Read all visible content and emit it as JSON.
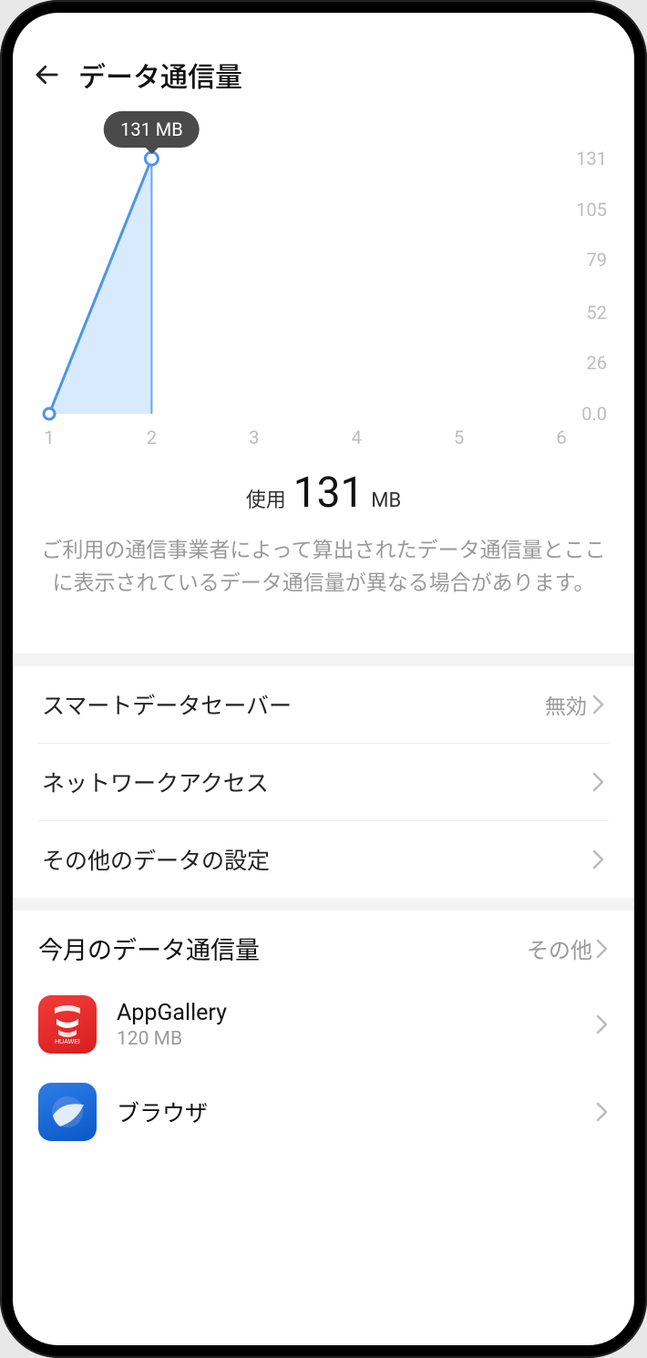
{
  "header": {
    "title": "データ通信量"
  },
  "chart_data": {
    "type": "area",
    "tooltip": "131 MB",
    "x": [
      1,
      2,
      3,
      4,
      5,
      6
    ],
    "values": [
      0,
      131,
      null,
      null,
      null,
      null
    ],
    "xlabel": "",
    "ylabel": "",
    "ylim": [
      0,
      131
    ],
    "xticks": [
      "1",
      "2",
      "3",
      "4",
      "5",
      "6"
    ],
    "yticks": [
      "131",
      "105",
      "79",
      "52",
      "26",
      "0.0"
    ]
  },
  "usage": {
    "prefix": "使用",
    "value": "131",
    "unit": "MB"
  },
  "disclaimer": "ご利用の通信事業者によって算出されたデータ通信量とここに表示されているデータ通信量が異なる場合があります。",
  "settings": [
    {
      "label": "スマートデータセーバー",
      "value": "無効"
    },
    {
      "label": "ネットワークアクセス",
      "value": ""
    },
    {
      "label": "その他のデータの設定",
      "value": ""
    }
  ],
  "month": {
    "title": "今月のデータ通信量",
    "more": "その他",
    "apps": [
      {
        "name": "AppGallery",
        "sub": "120 MB",
        "icon": "red",
        "iconLabel": "HUAWEI"
      },
      {
        "name": "ブラウザ",
        "sub": "",
        "icon": "blue",
        "iconLabel": ""
      }
    ]
  }
}
